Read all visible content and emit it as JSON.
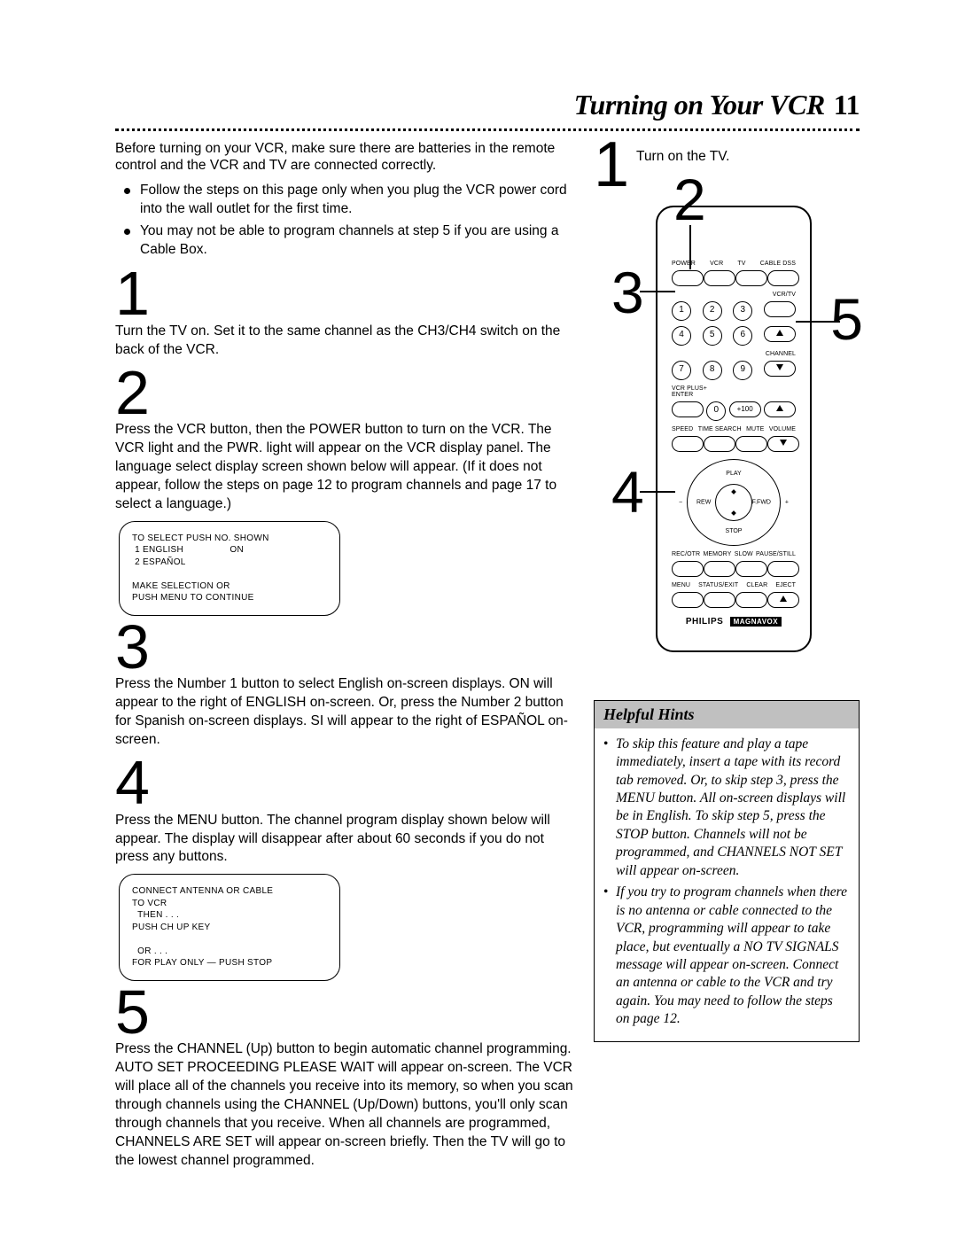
{
  "page": {
    "title": "Turning on Your VCR",
    "number": "11",
    "intro": "Before turning on your VCR, make sure there are batteries in the remote control and the VCR and TV are connected correctly.",
    "bullets": [
      "Follow the steps on this page only when you plug the VCR power cord into the wall outlet for the first time.",
      "You may not be able to program channels at step 5 if you are using a Cable Box."
    ]
  },
  "steps": [
    {
      "n": "1",
      "text": "Turn the TV on. Set it to the same channel as the CH3/CH4 switch on the back of the VCR."
    },
    {
      "n": "2",
      "text": "Press the VCR button, then the POWER button to turn on the VCR. The VCR light and the PWR. light will appear on the VCR display panel. The language select display screen shown below will appear. (If it does not appear, follow the steps on page 12 to program channels and page 17 to select a language.)",
      "osd": "TO SELECT PUSH NO. SHOWN\n 1 ENGLISH                 ON\n 2 ESPAÑOL\n\nMAKE SELECTION OR\nPUSH MENU TO CONTINUE"
    },
    {
      "n": "3",
      "text": "Press the Number 1 button to select English on-screen displays. ON will appear to the right of ENGLISH on-screen. Or, press the Number 2 button for Spanish on-screen displays. SI will appear to the right of ESPAÑOL on-screen."
    },
    {
      "n": "4",
      "text": "Press the MENU button. The channel program display shown below will appear. The display will disappear after about 60 seconds if you do not press any buttons.",
      "osd": "CONNECT ANTENNA OR CABLE\nTO VCR\n  THEN . . .\nPUSH CH UP KEY\n\n  OR . . .\nFOR PLAY ONLY — PUSH STOP"
    },
    {
      "n": "5",
      "text": "Press the CHANNEL (Up) button to begin automatic channel programming. AUTO SET PROCEEDING PLEASE WAIT will appear on-screen. The VCR will place all of the channels you receive into its memory, so when you scan through channels using the CHANNEL (Up/Down) buttons, you'll only scan through channels that you receive. When all channels are programmed, CHANNELS ARE SET will appear on-screen briefly. Then the TV will go to the lowest channel programmed."
    }
  ],
  "right": {
    "step1_num": "1",
    "step1_text": "Turn on the TV.",
    "callouts": {
      "c2": "2",
      "c3": "3",
      "c4": "4",
      "c5": "5"
    }
  },
  "remote": {
    "brand1": "PHILIPS",
    "brand2": "MAGNAVOX",
    "rows": {
      "labels_top": [
        "POWER",
        "VCR",
        "TV",
        "CABLE DSS"
      ],
      "labels_mid1": [
        "",
        "",
        "",
        "VCR/TV"
      ],
      "num1": [
        "1",
        "2",
        "3"
      ],
      "num2": [
        "4",
        "5",
        "6"
      ],
      "labels_ch": [
        "",
        "",
        "",
        "CHANNEL"
      ],
      "num3": [
        "7",
        "8",
        "9"
      ],
      "labels_vcrplus": [
        "VCR PLUS+\nENTER",
        "",
        "",
        ""
      ],
      "num4": [
        "",
        "0",
        "+100"
      ],
      "labels_fn": [
        "SPEED",
        "TIME SEARCH",
        "MUTE",
        "VOLUME"
      ],
      "nav": {
        "play": "PLAY",
        "rew": "REW",
        "ffwd": "F.FWD",
        "stop": "STOP"
      },
      "labels_bot1": [
        "REC/OTR",
        "MEMORY",
        "SLOW",
        "PAUSE/STILL"
      ],
      "labels_bot2": [
        "MENU",
        "STATUS/EXIT",
        "CLEAR",
        "EJECT"
      ]
    }
  },
  "hints": {
    "title": "Helpful Hints",
    "items": [
      "To skip this feature and play a tape immediately, insert a tape with its record tab removed. Or, to skip step 3, press the MENU button. All on-screen displays will be in English. To skip step 5, press the STOP button. Channels will not be programmed, and CHANNELS NOT SET will appear on-screen.",
      "If you try to program channels when there is no antenna or cable connected to the VCR, programming will appear to take place, but eventually a NO TV SIGNALS message will appear on-screen. Connect an antenna or cable to the VCR and try again. You may need to follow the steps on page 12."
    ]
  }
}
